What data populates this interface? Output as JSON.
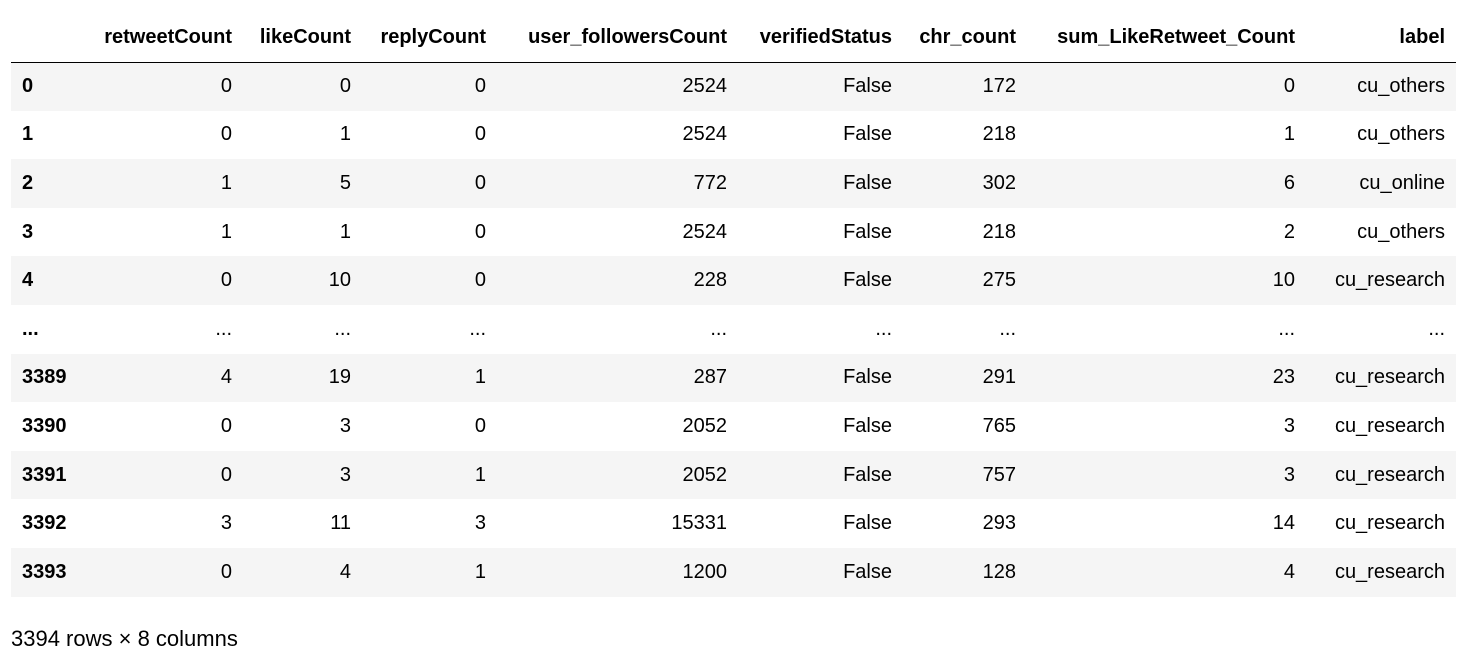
{
  "dataframe": {
    "columns": [
      "",
      "retweetCount",
      "likeCount",
      "replyCount",
      "user_followersCount",
      "verifiedStatus",
      "chr_count",
      "sum_LikeRetweet_Count",
      "label"
    ],
    "rows": [
      [
        "0",
        "0",
        "0",
        "0",
        "2524",
        "False",
        "172",
        "0",
        "cu_others"
      ],
      [
        "1",
        "0",
        "1",
        "0",
        "2524",
        "False",
        "218",
        "1",
        "cu_others"
      ],
      [
        "2",
        "1",
        "5",
        "0",
        "772",
        "False",
        "302",
        "6",
        "cu_online"
      ],
      [
        "3",
        "1",
        "1",
        "0",
        "2524",
        "False",
        "218",
        "2",
        "cu_others"
      ],
      [
        "4",
        "0",
        "10",
        "0",
        "228",
        "False",
        "275",
        "10",
        "cu_research"
      ],
      [
        "...",
        "...",
        "...",
        "...",
        "...",
        "...",
        "...",
        "...",
        "..."
      ],
      [
        "3389",
        "4",
        "19",
        "1",
        "287",
        "False",
        "291",
        "23",
        "cu_research"
      ],
      [
        "3390",
        "0",
        "3",
        "0",
        "2052",
        "False",
        "765",
        "3",
        "cu_research"
      ],
      [
        "3391",
        "0",
        "3",
        "1",
        "2052",
        "False",
        "757",
        "3",
        "cu_research"
      ],
      [
        "3392",
        "3",
        "11",
        "3",
        "15331",
        "False",
        "293",
        "14",
        "cu_research"
      ],
      [
        "3393",
        "0",
        "4",
        "1",
        "1200",
        "False",
        "128",
        "4",
        "cu_research"
      ]
    ],
    "footer": "3394 rows × 8 columns"
  }
}
